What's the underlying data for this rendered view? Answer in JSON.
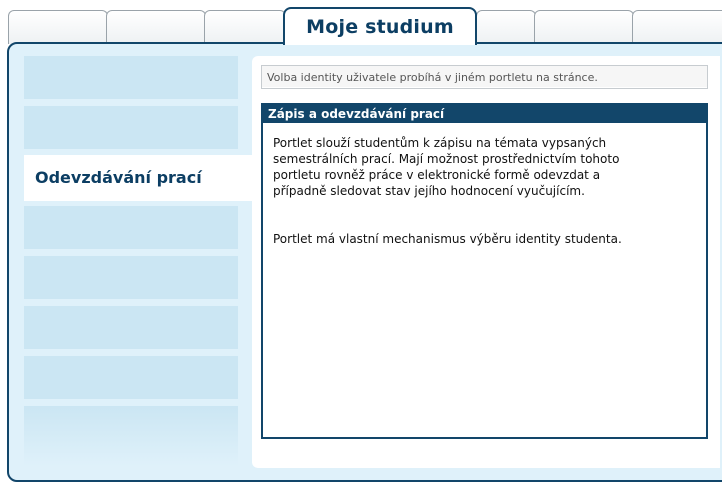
{
  "tabs": {
    "active_label": "Moje studium"
  },
  "sidebar": {
    "active_label": "Odevzdávání prací"
  },
  "identity_notice": "Volba identity uživatele probíhá v jiném portletu na stránce.",
  "portlet": {
    "title": "Zápis a odevzdávání prací",
    "paragraph1_line1": "Portlet slouží studentům k zápisu na témata vypsaných",
    "paragraph1_line2": "semestrálních prací. Mají možnost prostřednictvím tohoto",
    "paragraph1_line3": "portletu rovněž práce v elektronické formě odevzdat a",
    "paragraph1_line4": "případně sledovat stav jejího hodnocení vyučujícím.",
    "paragraph2": "Portlet má vlastní mechanismus výběru identity studenta."
  },
  "colors": {
    "accent": "#12466a",
    "frame_background": "#dff1fa",
    "nav_item": "#cbe6f3"
  }
}
